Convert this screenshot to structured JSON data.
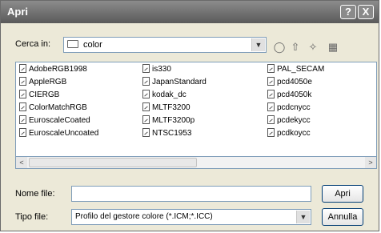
{
  "window": {
    "title": "Apri",
    "help_btn": "?",
    "close_btn": "X"
  },
  "lookin": {
    "label": "Cerca in:",
    "value": "color"
  },
  "files": [
    "AdobeRGB1998",
    "AppleRGB",
    "CIERGB",
    "ColorMatchRGB",
    "EuroscaleCoated",
    "EuroscaleUncoated",
    "is330",
    "JapanStandard",
    "kodak_dc",
    "MLTF3200",
    "MLTF3200p",
    "NTSC1953",
    "PAL_SECAM",
    "pcd4050e",
    "pcd4050k",
    "pcdcnycc",
    "pcdekycc",
    "pcdkoycc"
  ],
  "filename": {
    "label": "Nome file:",
    "value": ""
  },
  "filetype": {
    "label": "Tipo file:",
    "value": "Profilo del gestore colore (*.ICM;*.ICC)"
  },
  "buttons": {
    "open": "Apri",
    "cancel": "Annulla"
  },
  "scroll": {
    "left": "<",
    "right": ">"
  }
}
